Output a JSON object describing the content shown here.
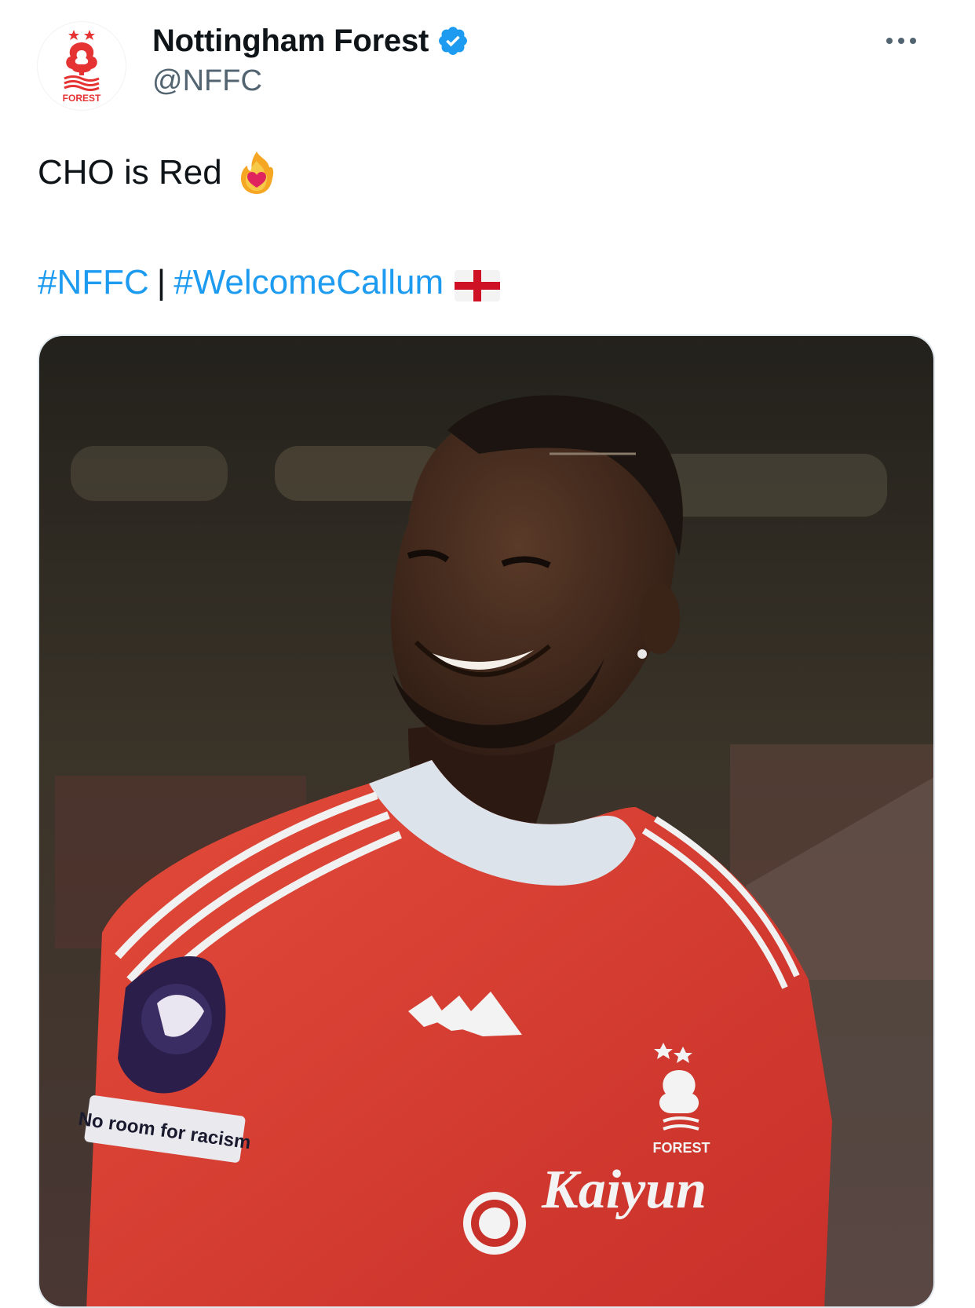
{
  "account": {
    "display_name": "Nottingham Forest",
    "handle": "@NFFC",
    "verified": true,
    "avatar_icon": "nottingham-forest-crest-icon",
    "avatar_text": "FOREST"
  },
  "tweet": {
    "text": "CHO is Red",
    "text_emoji": "heart-on-fire-emoji",
    "hashtags": [
      "#NFFC",
      "#WelcomeCallum"
    ],
    "separator": "|",
    "flag_emoji": "england-flag-emoji"
  },
  "media": {
    "kind": "photo",
    "subject": "player in red Nottingham Forest home shirt",
    "sleeve_badge_text": "No room for racism",
    "sponsor_text": "Kaiyun",
    "crest_text": "FOREST"
  },
  "colors": {
    "link": "#1d9bf0",
    "verified": "#1d9bf0",
    "secondary_text": "#536471",
    "shirt_red": "#d8392b"
  }
}
